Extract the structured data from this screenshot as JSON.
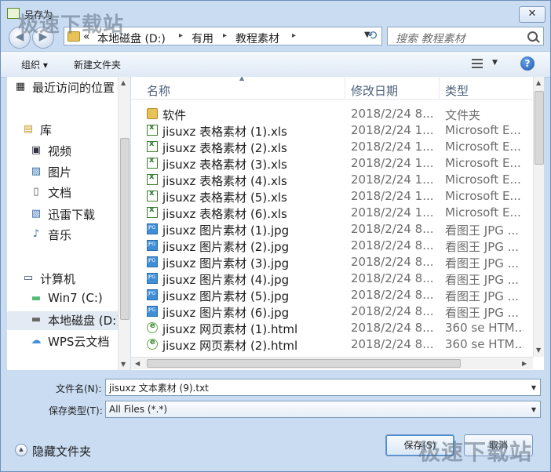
{
  "window": {
    "title": "另存为",
    "close_glyph": "✕"
  },
  "watermark": "极速下载站",
  "nav": {
    "back_glyph": "◀",
    "forward_glyph": "▶",
    "breadcrumb": [
      "«",
      "本地磁盘 (D:)",
      "有用",
      "教程素材"
    ],
    "refresh_glyph": "⟲",
    "search_placeholder": "搜索 教程素材"
  },
  "toolbar": {
    "organize": "组织 ▾",
    "new_folder": "新建文件夹",
    "help": "?"
  },
  "sidebar": {
    "items": [
      {
        "label": "最近访问的位置",
        "icon": "recent-places-icon",
        "glyph": "▦"
      },
      {
        "label": "库",
        "icon": "library-icon",
        "glyph": "▤"
      },
      {
        "label": "视频",
        "icon": "video-icon",
        "glyph": "▣"
      },
      {
        "label": "图片",
        "icon": "pictures-icon",
        "glyph": "▨"
      },
      {
        "label": "文档",
        "icon": "documents-icon",
        "glyph": "▯"
      },
      {
        "label": "迅雷下载",
        "icon": "download-folder-icon",
        "glyph": "▧"
      },
      {
        "label": "音乐",
        "icon": "music-icon",
        "glyph": "♪"
      },
      {
        "label": "计算机",
        "icon": "computer-icon",
        "glyph": "▭"
      },
      {
        "label": "Win7 (C:)",
        "icon": "drive-c-icon",
        "glyph": "▬"
      },
      {
        "label": "本地磁盘 (D:)",
        "icon": "drive-d-icon",
        "glyph": "▬"
      },
      {
        "label": "WPS云文档",
        "icon": "cloud-icon",
        "glyph": "☁"
      }
    ]
  },
  "columns": {
    "name": "名称",
    "date": "修改日期",
    "type": "类型"
  },
  "files": [
    {
      "name": "软件",
      "date": "2018/2/24 8...",
      "type": "文件夹",
      "icon": "folder"
    },
    {
      "name": "jisuxz 表格素材 (1).xls",
      "date": "2018/2/24 1...",
      "type": "Microsoft E...",
      "icon": "xls"
    },
    {
      "name": "jisuxz 表格素材 (2).xls",
      "date": "2018/2/24 1...",
      "type": "Microsoft E...",
      "icon": "xls"
    },
    {
      "name": "jisuxz 表格素材 (3).xls",
      "date": "2018/2/24 1...",
      "type": "Microsoft E...",
      "icon": "xls"
    },
    {
      "name": "jisuxz 表格素材 (4).xls",
      "date": "2018/2/24 1...",
      "type": "Microsoft E...",
      "icon": "xls"
    },
    {
      "name": "jisuxz 表格素材 (5).xls",
      "date": "2018/2/24 1...",
      "type": "Microsoft E...",
      "icon": "xls"
    },
    {
      "name": "jisuxz 表格素材 (6).xls",
      "date": "2018/2/24 1...",
      "type": "Microsoft E...",
      "icon": "xls"
    },
    {
      "name": "jisuxz 图片素材 (1).jpg",
      "date": "2018/2/24 8...",
      "type": "看图王 JPG ...",
      "icon": "jpg"
    },
    {
      "name": "jisuxz 图片素材 (2).jpg",
      "date": "2018/2/24 8...",
      "type": "看图王 JPG ...",
      "icon": "jpg"
    },
    {
      "name": "jisuxz 图片素材 (3).jpg",
      "date": "2018/2/24 8...",
      "type": "看图王 JPG ...",
      "icon": "jpg"
    },
    {
      "name": "jisuxz 图片素材 (4).jpg",
      "date": "2018/2/24 8...",
      "type": "看图王 JPG ...",
      "icon": "jpg"
    },
    {
      "name": "jisuxz 图片素材 (5).jpg",
      "date": "2018/2/24 8...",
      "type": "看图王 JPG ...",
      "icon": "jpg"
    },
    {
      "name": "jisuxz 图片素材 (6).jpg",
      "date": "2018/2/24 8...",
      "type": "看图王 JPG ...",
      "icon": "jpg"
    },
    {
      "name": "jisuxz 网页素材 (1).html",
      "date": "2018/2/24 8...",
      "type": "360 se HTM...",
      "icon": "html"
    },
    {
      "name": "jisuxz 网页素材 (2).html",
      "date": "2018/2/24 8...",
      "type": "360 se HTM...",
      "icon": "html"
    }
  ],
  "form": {
    "filename_label": "文件名(N):",
    "filename_value": "jisuxz 文本素材 (9).txt",
    "filetype_label": "保存类型(T):",
    "filetype_value": "All Files (*.*)"
  },
  "footer": {
    "hide_folders": "隐藏文件夹",
    "save_button": "保存(S)",
    "cancel_button": "取消"
  }
}
